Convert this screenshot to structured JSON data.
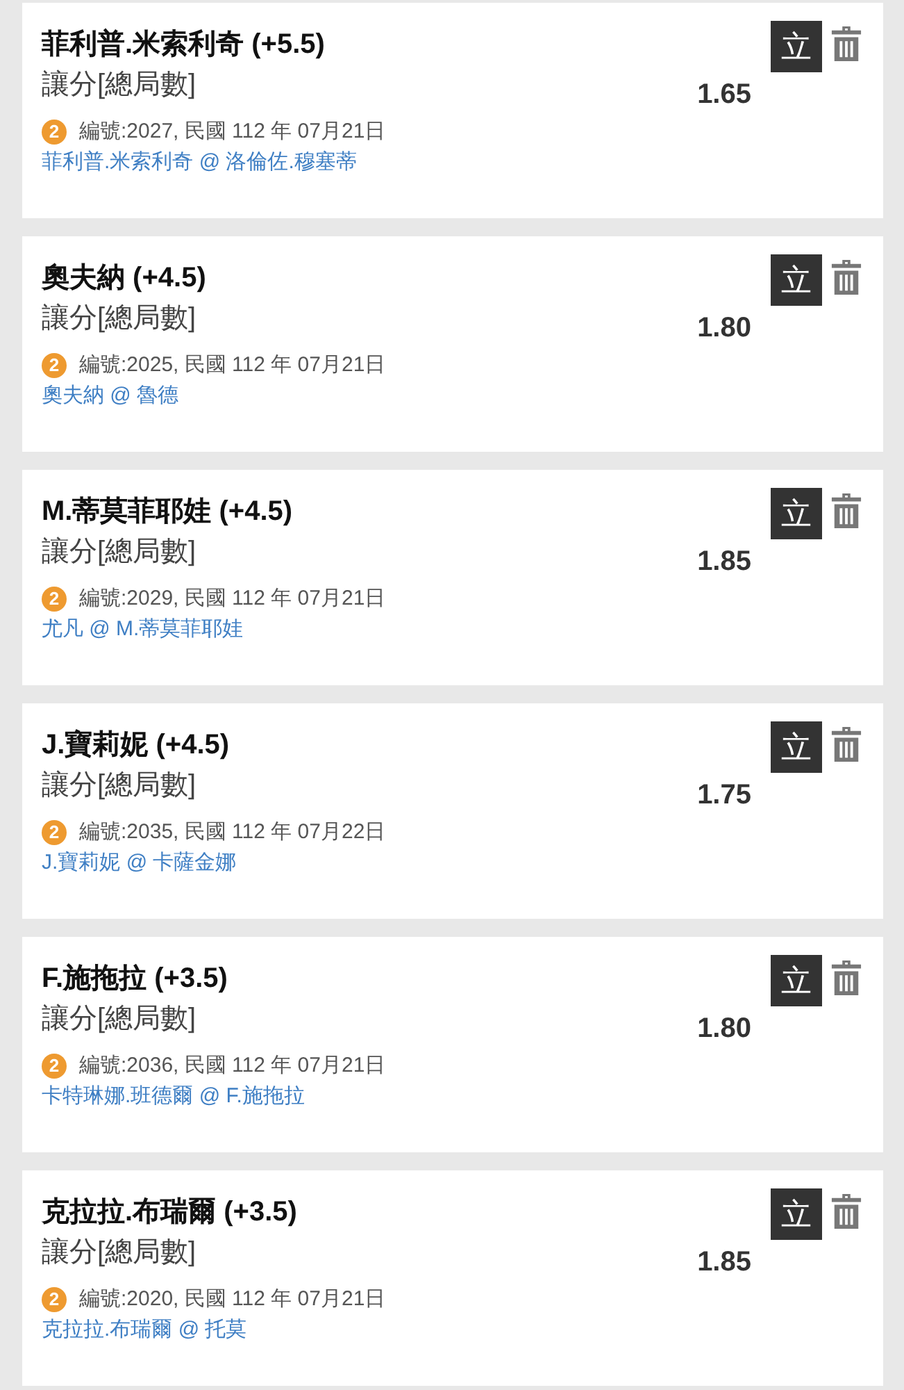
{
  "bets": [
    {
      "title": "菲利普.米索利奇 (+5.5)",
      "market": "讓分[總局數]",
      "odds": "1.65",
      "badge": "2",
      "info": "編號:2027, 民國 112 年 07月21日",
      "match": "菲利普.米索利奇 @ 洛倫佐.穆塞蒂",
      "action": "立"
    },
    {
      "title": "奧夫納 (+4.5)",
      "market": "讓分[總局數]",
      "odds": "1.80",
      "badge": "2",
      "info": "編號:2025, 民國 112 年 07月21日",
      "match": "奧夫納 @ 魯德",
      "action": "立"
    },
    {
      "title": "M.蒂莫菲耶娃 (+4.5)",
      "market": "讓分[總局數]",
      "odds": "1.85",
      "badge": "2",
      "info": "編號:2029, 民國 112 年 07月21日",
      "match": "尤凡 @ M.蒂莫菲耶娃",
      "action": "立"
    },
    {
      "title": "J.寶莉妮 (+4.5)",
      "market": "讓分[總局數]",
      "odds": "1.75",
      "badge": "2",
      "info": "編號:2035, 民國 112 年 07月22日",
      "match": "J.寶莉妮 @ 卡薩金娜",
      "action": "立"
    },
    {
      "title": "F.施拖拉 (+3.5)",
      "market": "讓分[總局數]",
      "odds": "1.80",
      "badge": "2",
      "info": "編號:2036, 民國 112 年 07月21日",
      "match": "卡特琳娜.班德爾 @ F.施拖拉",
      "action": "立"
    },
    {
      "title": "克拉拉.布瑞爾 (+3.5)",
      "market": "讓分[總局數]",
      "odds": "1.85",
      "badge": "2",
      "info": "編號:2020, 民國 112 年 07月21日",
      "match": "克拉拉.布瑞爾 @ 托莫",
      "action": "立"
    }
  ]
}
